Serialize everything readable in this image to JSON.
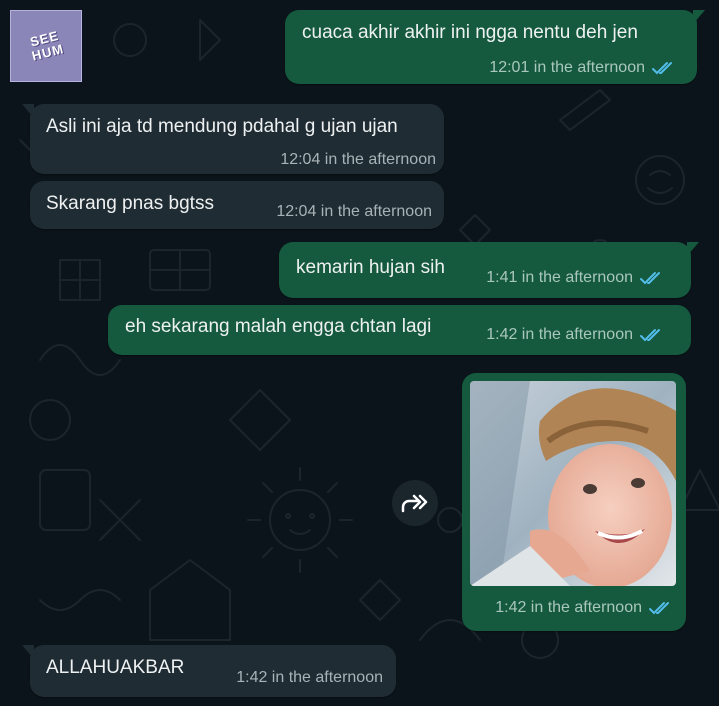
{
  "colors": {
    "background": "#0b141a",
    "outgoing_bubble": "#155a3e",
    "incoming_bubble": "#202c33",
    "read_ticks": "#53bdeb"
  },
  "sticker": {
    "text": "SEE\nHUM"
  },
  "messages": [
    {
      "direction": "out",
      "text": "cuaca akhir akhir ini ngga nentu deh jen",
      "time": "12:01 in the afternoon",
      "status": "read"
    },
    {
      "direction": "in",
      "text": "Asli ini aja td mendung pdahal g ujan ujan",
      "time": "12:04 in the afternoon"
    },
    {
      "direction": "in",
      "text": "Skarang pnas bgtss",
      "time": "12:04 in the afternoon"
    },
    {
      "direction": "out",
      "text": "kemarin hujan sih",
      "time": "1:41 in the afternoon",
      "status": "read"
    },
    {
      "direction": "out",
      "text": "eh sekarang malah engga chtan lagi",
      "time": "1:42 in the afternoon",
      "status": "read"
    },
    {
      "direction": "out",
      "type": "image",
      "time": "1:42 in the afternoon",
      "status": "read"
    },
    {
      "direction": "in",
      "text": "ALLAHUAKBAR",
      "time": "1:42 in the afternoon"
    }
  ],
  "icons": {
    "forward": "forward-icon",
    "read_status": "double-check-icon"
  }
}
